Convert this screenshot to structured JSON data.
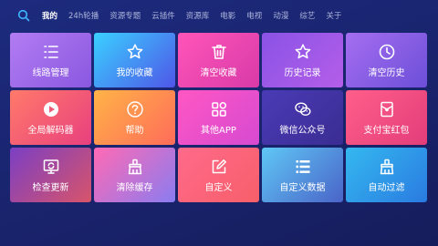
{
  "nav": {
    "items": [
      "我的",
      "24h轮播",
      "资源专题",
      "云插件",
      "资源库",
      "电影",
      "电视",
      "动漫",
      "综艺",
      "关于"
    ],
    "active_index": 0
  },
  "tiles": [
    {
      "label": "线路管理",
      "icon": "list-icon"
    },
    {
      "label": "我的收藏",
      "icon": "star-icon"
    },
    {
      "label": "清空收藏",
      "icon": "trash-icon"
    },
    {
      "label": "历史记录",
      "icon": "star-icon"
    },
    {
      "label": "清空历史",
      "icon": "clock-icon"
    },
    {
      "label": "全局解码器",
      "icon": "play-circle-icon"
    },
    {
      "label": "帮助",
      "icon": "question-icon"
    },
    {
      "label": "其他APP",
      "icon": "apps-grid-icon"
    },
    {
      "label": "微信公众号",
      "icon": "wechat-icon"
    },
    {
      "label": "支付宝红包",
      "icon": "red-packet-icon"
    },
    {
      "label": "检查更新",
      "icon": "monitor-refresh-icon"
    },
    {
      "label": "清除缓存",
      "icon": "broom-icon"
    },
    {
      "label": "自定义",
      "icon": "edit-icon"
    },
    {
      "label": "自定义数据",
      "icon": "list-icon"
    },
    {
      "label": "自动过滤",
      "icon": "broom-icon"
    }
  ]
}
